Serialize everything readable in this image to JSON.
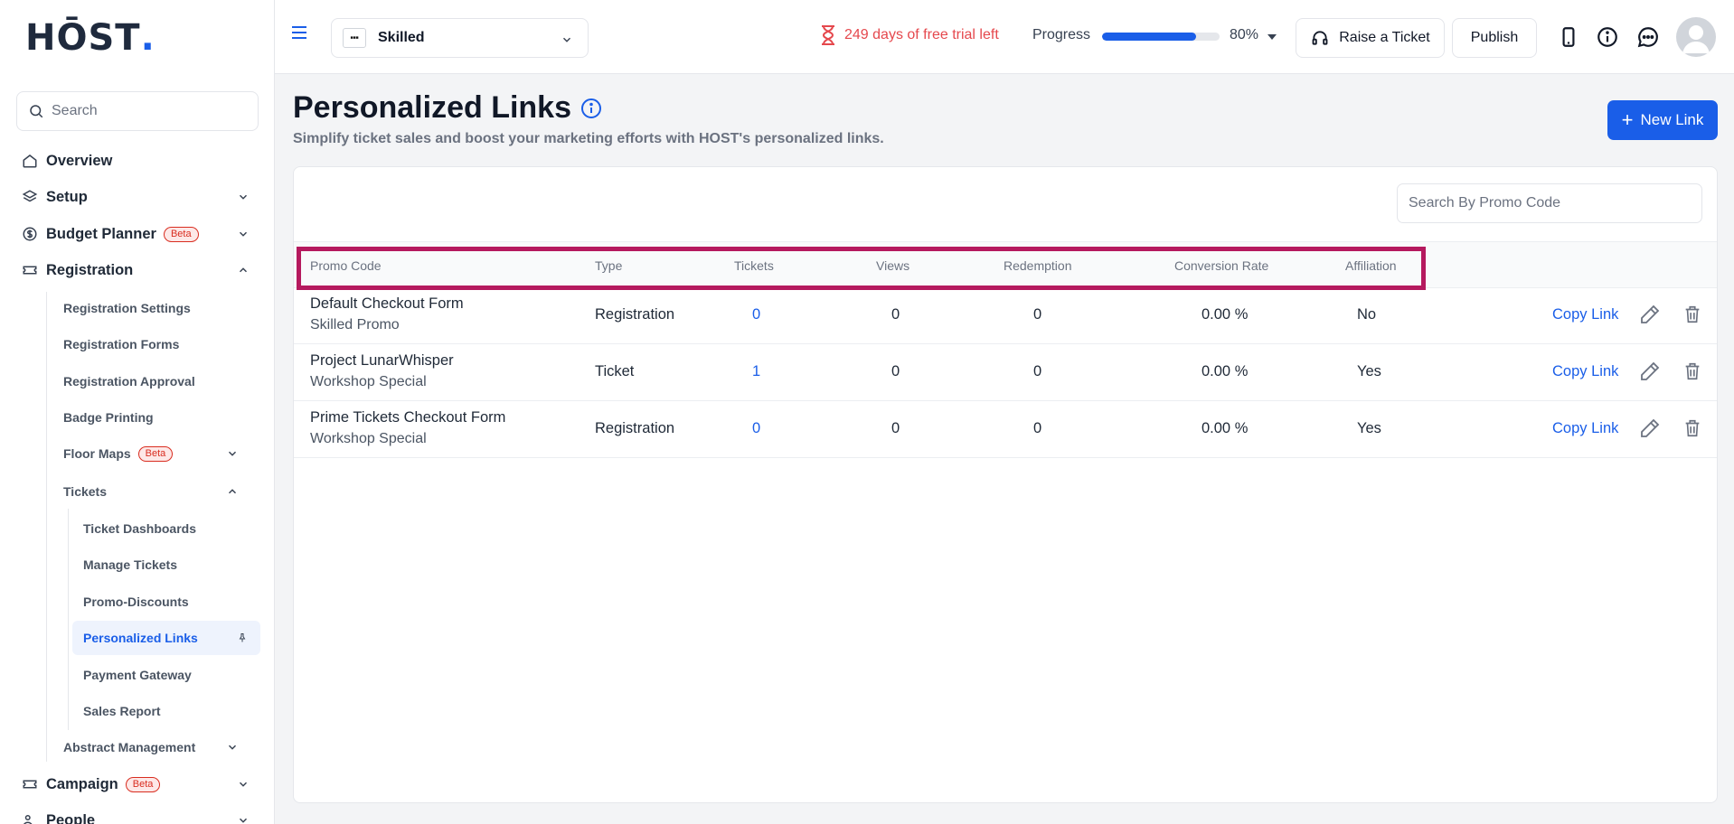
{
  "sidebar": {
    "logo": {
      "text": "HŌST",
      "dot": "."
    },
    "search_placeholder": "Search",
    "items": {
      "overview": "Overview",
      "setup": "Setup",
      "budget_planner": "Budget Planner",
      "registration": "Registration",
      "campaign": "Campaign",
      "people": "People"
    },
    "beta_label": "Beta",
    "registration_sub": {
      "settings": "Registration Settings",
      "forms": "Registration Forms",
      "approval": "Registration Approval",
      "badge": "Badge Printing",
      "floor_maps": "Floor Maps",
      "tickets": "Tickets",
      "abstract": "Abstract Management"
    },
    "tickets_sub": {
      "dashboards": "Ticket Dashboards",
      "manage": "Manage Tickets",
      "promo": "Promo-Discounts",
      "personalized": "Personalized Links",
      "payment": "Payment Gateway",
      "sales": "Sales Report"
    }
  },
  "topbar": {
    "event_name": "Skilled",
    "trial_text": "249 days of free trial left",
    "progress_label": "Progress",
    "progress_value": 0.8,
    "progress_pct": "80%",
    "raise_ticket": "Raise a Ticket",
    "publish": "Publish"
  },
  "page": {
    "title": "Personalized Links",
    "subtitle": "Simplify ticket sales and boost your marketing efforts with HOST's personalized links.",
    "new_link": "New Link",
    "promo_search_placeholder": "Search By Promo Code"
  },
  "table": {
    "headers": {
      "promo": "Promo Code",
      "type": "Type",
      "tickets": "Tickets",
      "views": "Views",
      "redemption": "Redemption",
      "conversion": "Conversion Rate",
      "affiliation": "Affiliation"
    },
    "copy_label": "Copy Link",
    "rows": [
      {
        "name": "Default Checkout Form",
        "sub": "Skilled Promo",
        "type": "Registration",
        "tickets": "0",
        "views": "0",
        "redemption": "0",
        "conversion": "0.00 %",
        "affiliation": "No"
      },
      {
        "name": "Project LunarWhisper",
        "sub": "Workshop Special",
        "type": "Ticket",
        "tickets": "1",
        "views": "0",
        "redemption": "0",
        "conversion": "0.00 %",
        "affiliation": "Yes"
      },
      {
        "name": "Prime Tickets Checkout Form",
        "sub": "Workshop Special",
        "type": "Registration",
        "tickets": "0",
        "views": "0",
        "redemption": "0",
        "conversion": "0.00 %",
        "affiliation": "Yes"
      }
    ]
  },
  "colors": {
    "accent": "#1a5ee8",
    "highlight": "#b5195e",
    "trial": "#e5484d"
  }
}
